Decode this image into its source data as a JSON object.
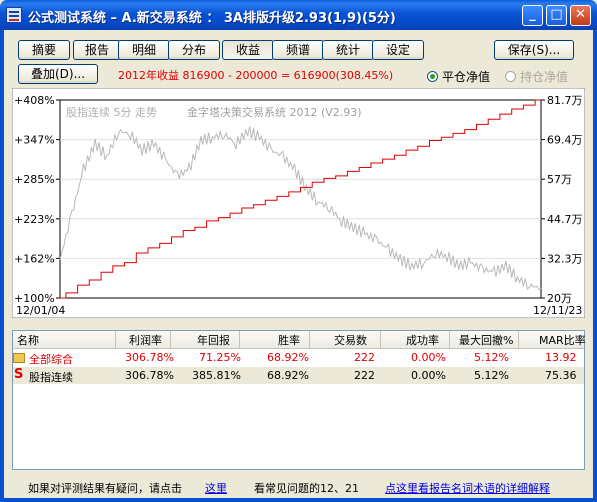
{
  "window": {
    "title": "公式测试系统 – A.新交易系统 ： 3A排版升级2.93(1,9)(5分)",
    "min": "_",
    "max": "□",
    "close": "✕"
  },
  "tabs": [
    "摘要",
    "报告",
    "明细",
    "分布",
    "收益",
    "频谱",
    "统计",
    "设定"
  ],
  "save_button": "保存(S)...",
  "overlay_button": "叠加(D)...",
  "formula_text": "2012年收益 816900 - 200000 = 616900(308.45%)",
  "radio": {
    "close_equity": "平仓净值",
    "hold_equity": "持仓净值"
  },
  "chart_data": {
    "type": "line",
    "watermark": "股指连续 5分 走势",
    "subtitle": "金字塔决策交易系统 2012 (V2.93)",
    "left_ticks": [
      "+408%",
      "+347%",
      "+285%",
      "+223%",
      "+162%",
      "+100%"
    ],
    "right_ticks": [
      "81.7万",
      "69.4万",
      "57万",
      "44.7万",
      "32.3万",
      "20万"
    ],
    "x_start": "12/01/04",
    "x_end": "12/11/23",
    "colors": {
      "equity": "#e00000",
      "price": "#b8b8b8"
    },
    "series": [
      {
        "name": "equity",
        "values": [
          100,
          108,
          120,
          128,
          140,
          150,
          155,
          170,
          178,
          185,
          195,
          205,
          210,
          220,
          225,
          232,
          240,
          245,
          252,
          258,
          265,
          272,
          280,
          286,
          290,
          297,
          303,
          310,
          316,
          322,
          330,
          336,
          345,
          350,
          356,
          362,
          370,
          378,
          386,
          394,
          400,
          408
        ]
      },
      {
        "values": [
          160,
          230,
          300,
          340,
          320,
          360,
          355,
          330,
          340,
          315,
          290,
          300,
          345,
          350,
          355,
          340,
          360,
          350,
          330,
          320,
          300,
          270,
          250,
          240,
          220,
          210,
          200,
          190,
          175,
          160,
          150,
          155,
          170,
          165,
          150,
          155,
          145,
          140,
          150,
          130,
          120,
          115
        ]
      }
    ]
  },
  "table": {
    "headers": [
      "名称",
      "利润率",
      "年回报",
      "胜率",
      "交易数",
      "成功率",
      "最大回撤%",
      "MAR比率"
    ],
    "rows": [
      [
        "全部综合",
        "306.78%",
        "71.25%",
        "68.92%",
        "222",
        "0.00%",
        "5.12%",
        "13.92"
      ],
      [
        "股指连续",
        "306.78%",
        "385.81%",
        "68.92%",
        "222",
        "0.00%",
        "5.12%",
        "75.36"
      ]
    ]
  },
  "footer": {
    "prompt": "如果对评测结果有疑问，请点击",
    "here": "这里",
    "faq": "看常见问题的12、21",
    "glossary": "点这里看报告名词术语的详细解释"
  }
}
